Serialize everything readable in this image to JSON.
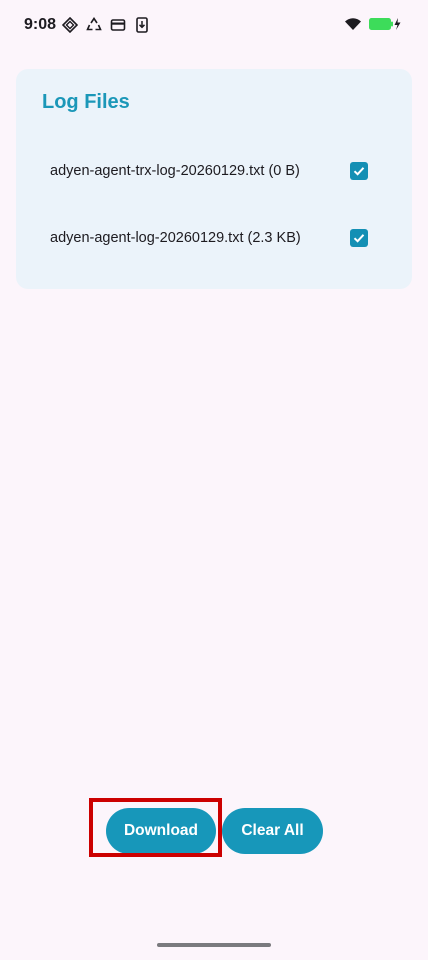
{
  "status_bar": {
    "time": "9:08",
    "left_icons": [
      "settings-diamond-icon",
      "recycle-icon",
      "card-icon",
      "phone-download-icon"
    ],
    "right_icons": [
      "wifi-icon",
      "battery-charging-icon"
    ],
    "battery_color": "#3ddc5a"
  },
  "log_files": {
    "title": "Log Files",
    "files": [
      {
        "label": "adyen-agent-trx-log-20260129.txt (0 B)",
        "checked": true
      },
      {
        "label": "adyen-agent-log-20260129.txt (2.3 KB)",
        "checked": true
      }
    ]
  },
  "actions": {
    "download_label": "Download",
    "clear_all_label": "Clear All"
  },
  "colors": {
    "accent": "#1797ba",
    "title": "#1b97b8",
    "card_bg": "#ebf3fa",
    "page_bg": "#fcf5fb",
    "highlight": "#cc0000"
  }
}
